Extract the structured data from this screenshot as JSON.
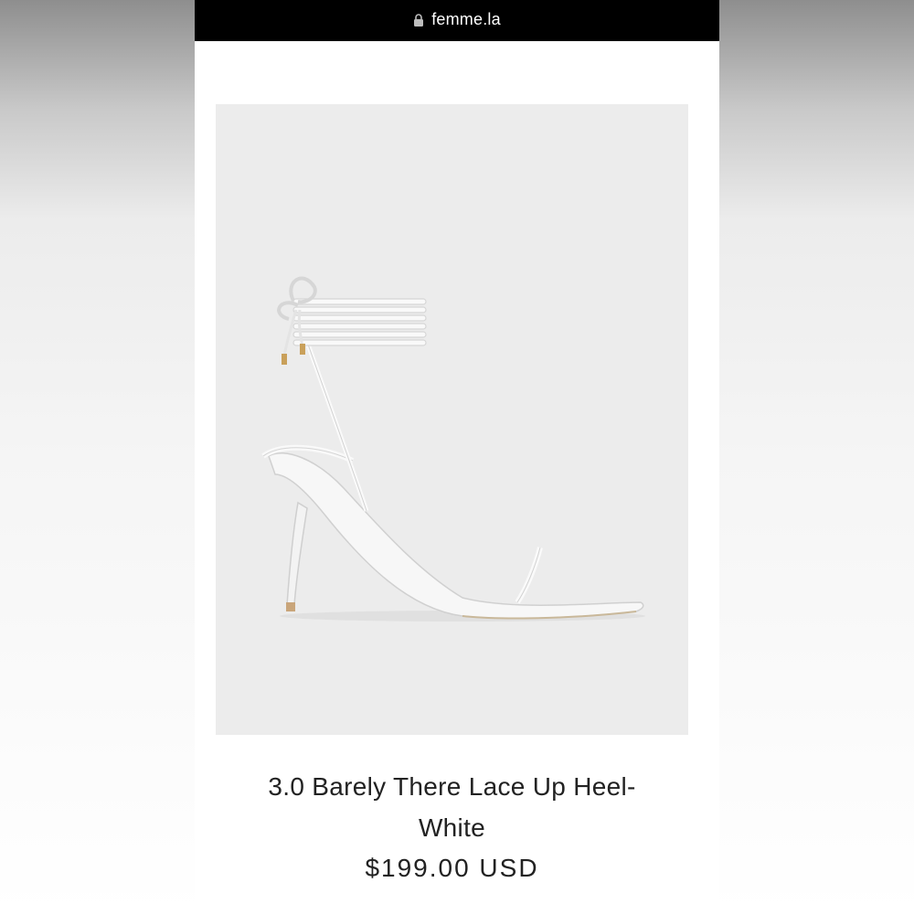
{
  "browser": {
    "url": "femme.la",
    "lock_icon": "lock-icon"
  },
  "product": {
    "title_line1": "3.0 Barely There Lace Up Heel-",
    "title_line2": "White",
    "price": "$199.00 USD",
    "image_alt": "white lace-up heeled sandal"
  },
  "colors": {
    "url_bar": "#000000",
    "image_background": "#ececec",
    "text": "#222222"
  }
}
